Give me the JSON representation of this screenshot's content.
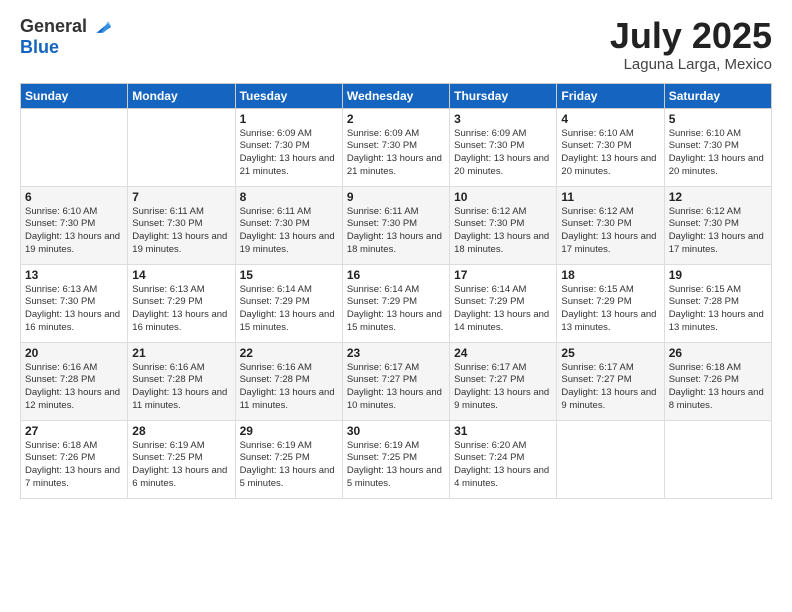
{
  "header": {
    "logo_general": "General",
    "logo_blue": "Blue",
    "main_title": "July 2025",
    "subtitle": "Laguna Larga, Mexico"
  },
  "columns": [
    "Sunday",
    "Monday",
    "Tuesday",
    "Wednesday",
    "Thursday",
    "Friday",
    "Saturday"
  ],
  "weeks": [
    [
      {
        "day": "",
        "info": ""
      },
      {
        "day": "",
        "info": ""
      },
      {
        "day": "1",
        "info": "Sunrise: 6:09 AM\nSunset: 7:30 PM\nDaylight: 13 hours and 21 minutes."
      },
      {
        "day": "2",
        "info": "Sunrise: 6:09 AM\nSunset: 7:30 PM\nDaylight: 13 hours and 21 minutes."
      },
      {
        "day": "3",
        "info": "Sunrise: 6:09 AM\nSunset: 7:30 PM\nDaylight: 13 hours and 20 minutes."
      },
      {
        "day": "4",
        "info": "Sunrise: 6:10 AM\nSunset: 7:30 PM\nDaylight: 13 hours and 20 minutes."
      },
      {
        "day": "5",
        "info": "Sunrise: 6:10 AM\nSunset: 7:30 PM\nDaylight: 13 hours and 20 minutes."
      }
    ],
    [
      {
        "day": "6",
        "info": "Sunrise: 6:10 AM\nSunset: 7:30 PM\nDaylight: 13 hours and 19 minutes."
      },
      {
        "day": "7",
        "info": "Sunrise: 6:11 AM\nSunset: 7:30 PM\nDaylight: 13 hours and 19 minutes."
      },
      {
        "day": "8",
        "info": "Sunrise: 6:11 AM\nSunset: 7:30 PM\nDaylight: 13 hours and 19 minutes."
      },
      {
        "day": "9",
        "info": "Sunrise: 6:11 AM\nSunset: 7:30 PM\nDaylight: 13 hours and 18 minutes."
      },
      {
        "day": "10",
        "info": "Sunrise: 6:12 AM\nSunset: 7:30 PM\nDaylight: 13 hours and 18 minutes."
      },
      {
        "day": "11",
        "info": "Sunrise: 6:12 AM\nSunset: 7:30 PM\nDaylight: 13 hours and 17 minutes."
      },
      {
        "day": "12",
        "info": "Sunrise: 6:12 AM\nSunset: 7:30 PM\nDaylight: 13 hours and 17 minutes."
      }
    ],
    [
      {
        "day": "13",
        "info": "Sunrise: 6:13 AM\nSunset: 7:30 PM\nDaylight: 13 hours and 16 minutes."
      },
      {
        "day": "14",
        "info": "Sunrise: 6:13 AM\nSunset: 7:29 PM\nDaylight: 13 hours and 16 minutes."
      },
      {
        "day": "15",
        "info": "Sunrise: 6:14 AM\nSunset: 7:29 PM\nDaylight: 13 hours and 15 minutes."
      },
      {
        "day": "16",
        "info": "Sunrise: 6:14 AM\nSunset: 7:29 PM\nDaylight: 13 hours and 15 minutes."
      },
      {
        "day": "17",
        "info": "Sunrise: 6:14 AM\nSunset: 7:29 PM\nDaylight: 13 hours and 14 minutes."
      },
      {
        "day": "18",
        "info": "Sunrise: 6:15 AM\nSunset: 7:29 PM\nDaylight: 13 hours and 13 minutes."
      },
      {
        "day": "19",
        "info": "Sunrise: 6:15 AM\nSunset: 7:28 PM\nDaylight: 13 hours and 13 minutes."
      }
    ],
    [
      {
        "day": "20",
        "info": "Sunrise: 6:16 AM\nSunset: 7:28 PM\nDaylight: 13 hours and 12 minutes."
      },
      {
        "day": "21",
        "info": "Sunrise: 6:16 AM\nSunset: 7:28 PM\nDaylight: 13 hours and 11 minutes."
      },
      {
        "day": "22",
        "info": "Sunrise: 6:16 AM\nSunset: 7:28 PM\nDaylight: 13 hours and 11 minutes."
      },
      {
        "day": "23",
        "info": "Sunrise: 6:17 AM\nSunset: 7:27 PM\nDaylight: 13 hours and 10 minutes."
      },
      {
        "day": "24",
        "info": "Sunrise: 6:17 AM\nSunset: 7:27 PM\nDaylight: 13 hours and 9 minutes."
      },
      {
        "day": "25",
        "info": "Sunrise: 6:17 AM\nSunset: 7:27 PM\nDaylight: 13 hours and 9 minutes."
      },
      {
        "day": "26",
        "info": "Sunrise: 6:18 AM\nSunset: 7:26 PM\nDaylight: 13 hours and 8 minutes."
      }
    ],
    [
      {
        "day": "27",
        "info": "Sunrise: 6:18 AM\nSunset: 7:26 PM\nDaylight: 13 hours and 7 minutes."
      },
      {
        "day": "28",
        "info": "Sunrise: 6:19 AM\nSunset: 7:25 PM\nDaylight: 13 hours and 6 minutes."
      },
      {
        "day": "29",
        "info": "Sunrise: 6:19 AM\nSunset: 7:25 PM\nDaylight: 13 hours and 5 minutes."
      },
      {
        "day": "30",
        "info": "Sunrise: 6:19 AM\nSunset: 7:25 PM\nDaylight: 13 hours and 5 minutes."
      },
      {
        "day": "31",
        "info": "Sunrise: 6:20 AM\nSunset: 7:24 PM\nDaylight: 13 hours and 4 minutes."
      },
      {
        "day": "",
        "info": ""
      },
      {
        "day": "",
        "info": ""
      }
    ]
  ]
}
